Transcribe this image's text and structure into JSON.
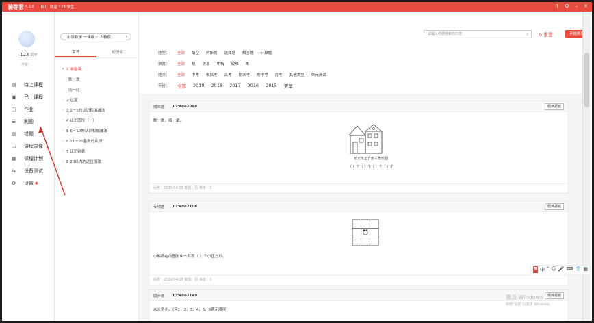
{
  "titlebar": {
    "logo": "骑等君",
    "version": "4.3.6",
    "greeting": "Hi！ 欢迎 123 学生",
    "icons": [
      "help-icon",
      "settings-icon",
      "minimize-icon",
      "close-icon"
    ]
  },
  "user": {
    "name": "123",
    "name_suffix": "同学",
    "school": "学校："
  },
  "nav": [
    {
      "label": "待上课程",
      "icon": "calendar-icon"
    },
    {
      "label": "已上课程",
      "icon": "calendar-check-icon"
    },
    {
      "label": "作业",
      "icon": "homework-icon"
    },
    {
      "label": "刷题",
      "icon": "practice-icon"
    },
    {
      "label": "错题",
      "icon": "wrong-book-icon"
    },
    {
      "label": "课程录像",
      "icon": "video-icon"
    },
    {
      "label": "课程计划",
      "icon": "plan-icon"
    },
    {
      "label": "设备测试",
      "icon": "device-test-icon"
    },
    {
      "label": "设置",
      "icon": "gear-icon",
      "dot": "●"
    }
  ],
  "grade_selector": {
    "label": "小学数学 一年级上 人教版",
    "chevron": "›"
  },
  "tree_tabs": [
    {
      "label": "章节"
    },
    {
      "label": "知识点"
    }
  ],
  "chapters": [
    {
      "label": "1 准备课",
      "active": true,
      "arrow": "▾",
      "level": 1
    },
    {
      "label": "数一数",
      "level": 2
    },
    {
      "label": "比一比",
      "level": 2
    },
    {
      "label": "2 位置",
      "arrow": "›",
      "level": 1
    },
    {
      "label": "3 1－5的认识和加减法",
      "arrow": "›",
      "level": 1
    },
    {
      "label": "4 认识图形（一）",
      "arrow": "›",
      "level": 1
    },
    {
      "label": "5 6－10的认识和加减法",
      "arrow": "›",
      "level": 1
    },
    {
      "label": "6 11－20各数的认识",
      "arrow": "›",
      "level": 1
    },
    {
      "label": "7 认识钟表",
      "arrow": "›",
      "level": 1
    },
    {
      "label": "8 20以内的进位加法",
      "arrow": "›",
      "level": 1
    }
  ],
  "search": {
    "placeholder": "请输入你要搜索的内容",
    "icon": "search-icon"
  },
  "reset_label": "重置",
  "start_label": "开始刷题",
  "filters": [
    {
      "label": "题型：",
      "options": [
        "全部",
        "填空",
        "判断题",
        "选择题",
        "解答题",
        "计算题"
      ],
      "selected": 0
    },
    {
      "label": "难度：",
      "options": [
        "全部",
        "易",
        "较易",
        "中档",
        "较难",
        "难"
      ],
      "selected": 0
    },
    {
      "label": "题类：",
      "options": [
        "全部",
        "中考",
        "模拟考",
        "高考",
        "期末考",
        "期中考",
        "月考",
        "其他类型",
        "单元测试"
      ],
      "selected": 0
    },
    {
      "label": "年份：",
      "options": [
        "全部",
        "2019",
        "2018",
        "2017",
        "2016",
        "2015",
        "更早"
      ],
      "selected": 0,
      "year": true
    }
  ],
  "questions": [
    {
      "type": "期末题",
      "id": "ID:4862088",
      "button": "题目报错",
      "text": "数一数，填一填。",
      "caption1": "长方形正方形三角形圆",
      "caption2": "（ ）个（ ）个（ ）个（ ）个",
      "footer": "组卷：2020/04/18 真题：否 难度：3"
    },
    {
      "type": "专项题",
      "id": "ID:4862106",
      "button": "题目报错",
      "text": "小熊所在的图形中一共有（ ）个小正方形。",
      "footer": "组卷：2020/04/18 真题：否 难度：3"
    },
    {
      "type": "同步题",
      "id": "ID:4862149",
      "button": "题目报错",
      "text": "从大到小。（用1，2，3，4，5，6表示顺序）"
    }
  ],
  "ime": {
    "logo": "S",
    "items": [
      "中",
      "°",
      "☺",
      "🎤",
      "⌨",
      "👕",
      "▦"
    ]
  },
  "watermark": {
    "line1": "激活 Windows",
    "line2": "转到\"设置\"以激活 Windows。"
  },
  "colors": {
    "accent": "#e84a3d"
  }
}
